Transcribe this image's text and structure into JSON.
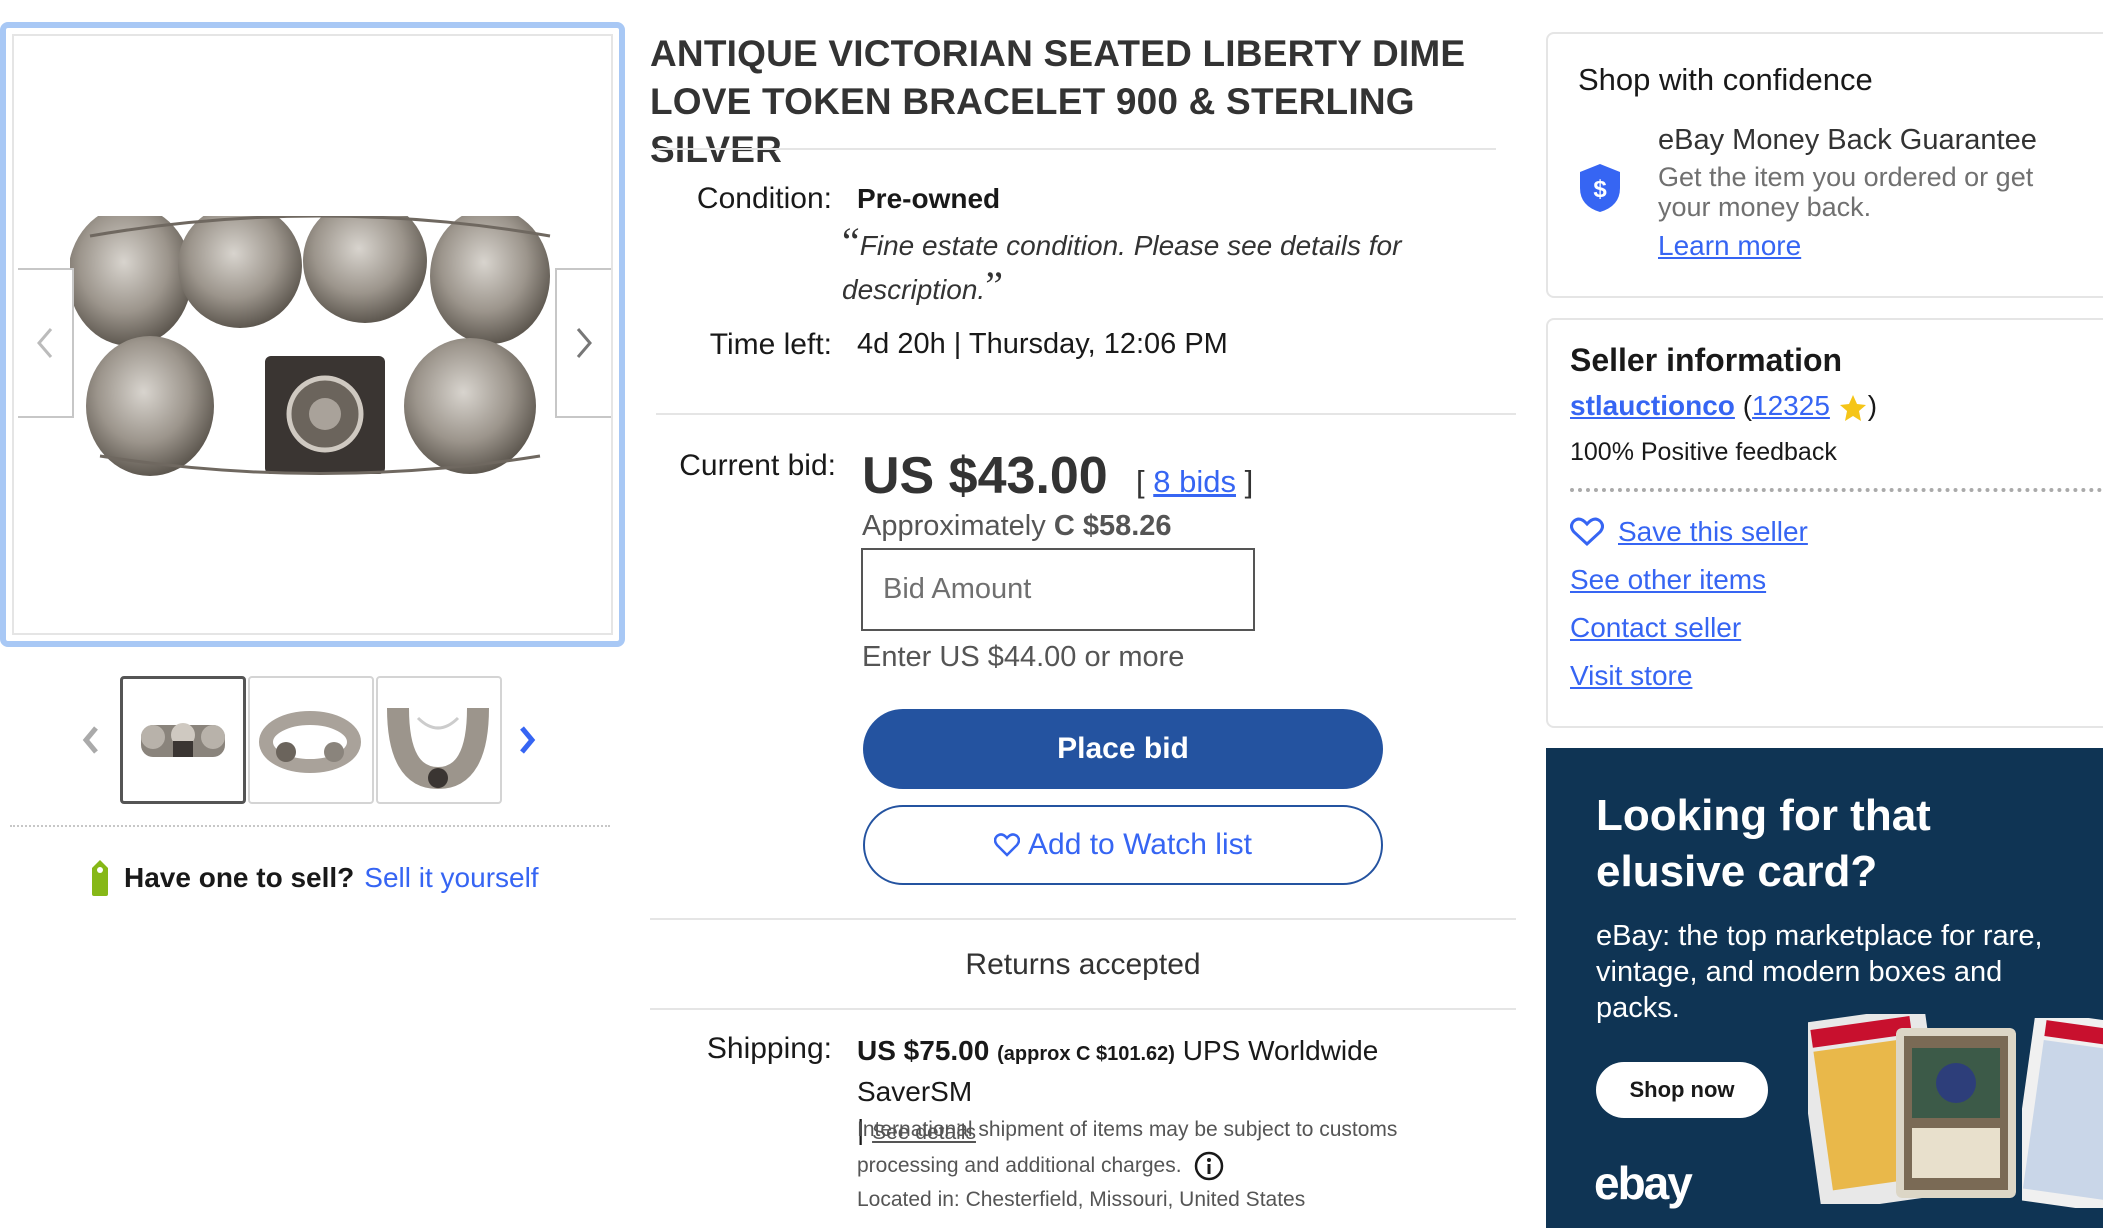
{
  "gallery": {
    "prev_icon": "chevron-left-icon",
    "next_icon": "chevron-right-icon"
  },
  "listing": {
    "title_line1": "ANTIQUE VICTORIAN SEATED LIBERTY DIME",
    "title_line2": "LOVE TOKEN BRACELET 900 & STERLING SILVER",
    "condition_label": "Condition:",
    "condition_value": "Pre-owned",
    "condition_note": "Fine estate condition. Please see details for description.",
    "time_left_label": "Time left:",
    "time_left_value": "4d 20h",
    "time_left_sep": "|",
    "time_left_end": "Thursday, 12:06 PM",
    "current_bid_label": "Current bid:",
    "current_bid": "US $43.00",
    "bids_open": "[",
    "bids_link": "8 bids",
    "bids_close": "]",
    "approx_prefix": "Approximately",
    "approx_value": "C $58.26",
    "bid_placeholder": "Bid Amount",
    "enter_more": "Enter US $44.00 or more",
    "place_bid": "Place bid",
    "watch_label": "Add to Watch list",
    "returns": "Returns accepted",
    "shipping_label": "Shipping:",
    "shipping_price": "US $75.00",
    "shipping_approx": "(approx C $101.62)",
    "shipping_service": "UPS Worldwide SaverSM",
    "shipping_sep": "|",
    "see_details": "See details",
    "intl_note": "International shipment of items may be subject to customs processing and additional charges.",
    "located": "Located in: Chesterfield, Missouri, United States"
  },
  "sell": {
    "question": "Have one to sell?",
    "link": "Sell it yourself"
  },
  "confidence": {
    "title": "Shop with confidence",
    "guarantee_title": "eBay Money Back Guarantee",
    "guarantee_desc": "Get the item you ordered or get your money back.",
    "learn_more": "Learn more"
  },
  "seller": {
    "title": "Seller information",
    "name": "stlauctionco",
    "open_paren": "(",
    "feedback_count": "12325",
    "close_paren": ")",
    "positive": "100% Positive feedback",
    "save": "Save this seller",
    "other_items": "See other items",
    "contact": "Contact seller",
    "visit_store": "Visit store"
  },
  "ad": {
    "headline": "Looking for that elusive card?",
    "subtext": "eBay: the top marketplace for rare, vintage, and modern boxes and packs.",
    "button": "Shop now",
    "logo": "ebay"
  },
  "colors": {
    "primary_button": "#2453a0",
    "link": "#3665f3",
    "ad_background": "#0f3454",
    "gallery_focus": "#a8c8f5"
  }
}
